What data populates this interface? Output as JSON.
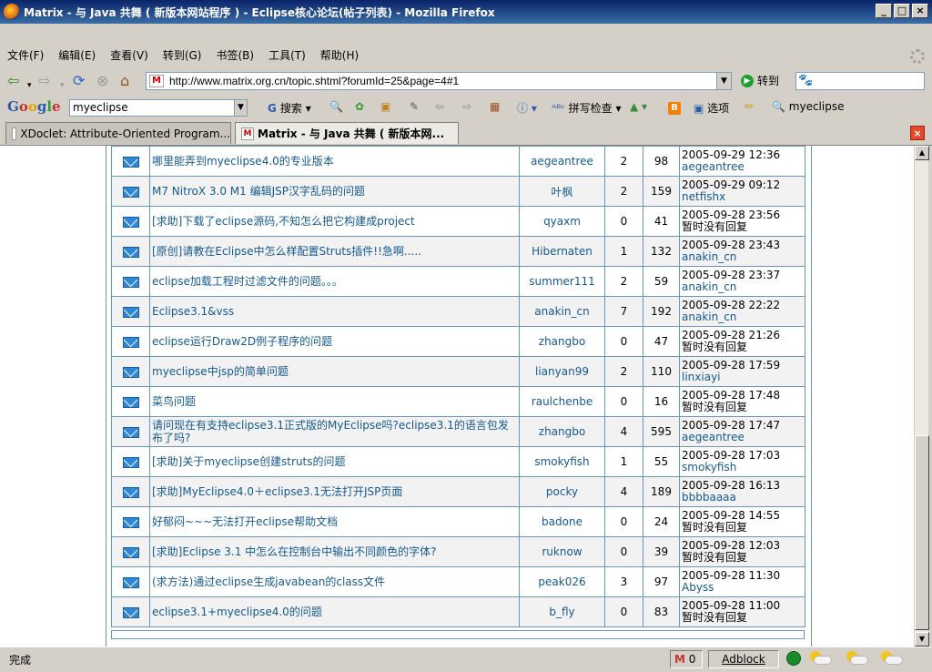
{
  "window": {
    "title": "Matrix - 与 Java 共舞 ( 新版本网站程序 ) - Eclipse核心论坛(帖子列表) - Mozilla Firefox",
    "buttons": [
      "_",
      "□",
      "×"
    ]
  },
  "menu": [
    "文件(F)",
    "编辑(E)",
    "查看(V)",
    "转到(G)",
    "书签(B)",
    "工具(T)",
    "帮助(H)"
  ],
  "nav": {
    "url": "http://www.matrix.org.cn/topic.shtml?forumId=25&page=4#1",
    "go_label": "转到"
  },
  "google_toolbar": {
    "logo": "Google",
    "query": "myeclipse",
    "search_label": "搜索",
    "spellcheck_label": "拼写检查",
    "options_label": "选项",
    "highlight_term": "myeclipse"
  },
  "tabs": [
    {
      "label": "XDoclet: Attribute-Oriented Program...",
      "active": false
    },
    {
      "label": "Matrix - 与 Java 共舞 ( 新版本网...",
      "active": true
    }
  ],
  "topics": [
    {
      "title": "哪里能弄到myeclipse4.0的专业版本",
      "author": "aegeantree",
      "replies": "2",
      "views": "98",
      "last_date": "2005-09-29 12:36",
      "last_user": "aegeantree"
    },
    {
      "title": "M7 NitroX 3.0 M1 编辑JSP汉字乱码的问题",
      "author": "叶枫",
      "replies": "2",
      "views": "159",
      "last_date": "2005-09-29 09:12",
      "last_user": "netfishx"
    },
    {
      "title": "[求助]下载了eclipse源码,不知怎么把它构建成project",
      "author": "qyaxm",
      "replies": "0",
      "views": "41",
      "last_date": "2005-09-28 23:56",
      "last_user": "暂时没有回复"
    },
    {
      "title": "[原创]请教在Eclipse中怎么样配置Struts插件!!急啊.....",
      "author": "Hibernaten",
      "replies": "1",
      "views": "132",
      "last_date": "2005-09-28 23:43",
      "last_user": "anakin_cn"
    },
    {
      "title": "eclipse加载工程时过滤文件的问题。。。",
      "author": "summer111",
      "replies": "2",
      "views": "59",
      "last_date": "2005-09-28 23:37",
      "last_user": "anakin_cn"
    },
    {
      "title": "Eclipse3.1&vss",
      "author": "anakin_cn",
      "replies": "7",
      "views": "192",
      "last_date": "2005-09-28 22:22",
      "last_user": "anakin_cn"
    },
    {
      "title": "eclipse运行Draw2D例子程序的问题",
      "author": "zhangbo",
      "replies": "0",
      "views": "47",
      "last_date": "2005-09-28 21:26",
      "last_user": "暂时没有回复"
    },
    {
      "title": "myeclipse中jsp的简单问题",
      "author": "lianyan99",
      "replies": "2",
      "views": "110",
      "last_date": "2005-09-28 17:59",
      "last_user": "linxiayi"
    },
    {
      "title": "菜鸟问题",
      "author": "raulchenbe",
      "replies": "0",
      "views": "16",
      "last_date": "2005-09-28 17:48",
      "last_user": "暂时没有回复"
    },
    {
      "title": "请问现在有支持eclipse3.1正式版的MyEclipse吗?eclipse3.1的语言包发布了吗?",
      "author": "zhangbo",
      "replies": "4",
      "views": "595",
      "last_date": "2005-09-28 17:47",
      "last_user": "aegeantree"
    },
    {
      "title": "[求助]关于myeclipse创建struts的问题",
      "author": "smokyfish",
      "replies": "1",
      "views": "55",
      "last_date": "2005-09-28 17:03",
      "last_user": "smokyfish"
    },
    {
      "title": "[求助]MyEclipse4.0＋eclipse3.1无法打开JSP页面",
      "author": "pocky",
      "replies": "4",
      "views": "189",
      "last_date": "2005-09-28 16:13",
      "last_user": "bbbbaaaa"
    },
    {
      "title": "好郁闷~~~无法打开eclipse帮助文档",
      "author": "badone",
      "replies": "0",
      "views": "24",
      "last_date": "2005-09-28 14:55",
      "last_user": "暂时没有回复"
    },
    {
      "title": "[求助]Eclipse 3.1 中怎么在控制台中输出不同颜色的字体?",
      "author": "ruknow",
      "replies": "0",
      "views": "39",
      "last_date": "2005-09-28 12:03",
      "last_user": "暂时没有回复"
    },
    {
      "title": "(求方法)通过eclipse生成javabean的class文件",
      "author": "peak026",
      "replies": "3",
      "views": "97",
      "last_date": "2005-09-28 11:30",
      "last_user": "Abyss"
    },
    {
      "title": "eclipse3.1+myeclipse4.0的问题",
      "author": "b_fly",
      "replies": "0",
      "views": "83",
      "last_date": "2005-09-28 11:00",
      "last_user": "暂时没有回复"
    }
  ],
  "status": {
    "text": "完成",
    "gmail_count": "0",
    "adblock_label": "Adblock"
  },
  "colors": {
    "link": "#15598f",
    "table_border": "#6a96bd",
    "title_bar": "#0a246a"
  }
}
